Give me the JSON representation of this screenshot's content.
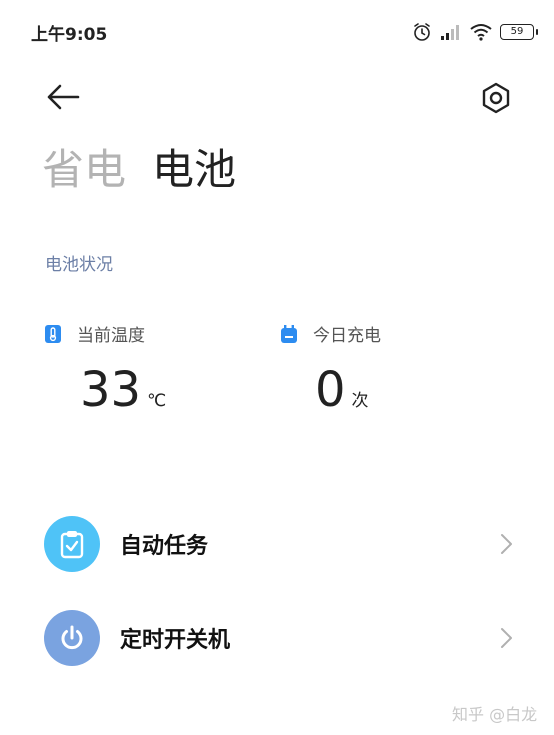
{
  "status_bar": {
    "time": "上午9:05",
    "battery_level": "59",
    "icons": [
      "alarm-icon",
      "signal-icon",
      "wifi-icon",
      "battery-icon"
    ]
  },
  "header": {
    "back_icon": "arrow-left-icon",
    "settings_icon": "hexagon-settings-icon",
    "tabs": [
      {
        "label": "省电",
        "active": false
      },
      {
        "label": "电池",
        "active": true
      }
    ]
  },
  "battery_status": {
    "section_title": "电池状况",
    "temperature": {
      "label": "当前温度",
      "value": "33",
      "unit": "℃",
      "icon": "thermometer-icon"
    },
    "charges_today": {
      "label": "今日充电",
      "value": "0",
      "unit": "次",
      "icon": "battery-charge-icon"
    }
  },
  "list": {
    "items": [
      {
        "label": "自动任务",
        "icon": "clipboard-check-icon",
        "icon_color": "#4fc3f7"
      },
      {
        "label": "定时开关机",
        "icon": "power-icon",
        "icon_color": "#7aa3e0"
      }
    ]
  },
  "watermark": "知乎 @白龙",
  "colors": {
    "accent_blue": "#2d8cf0",
    "section_title": "#6c7fa6",
    "inactive_tab": "#b3b3b3"
  }
}
